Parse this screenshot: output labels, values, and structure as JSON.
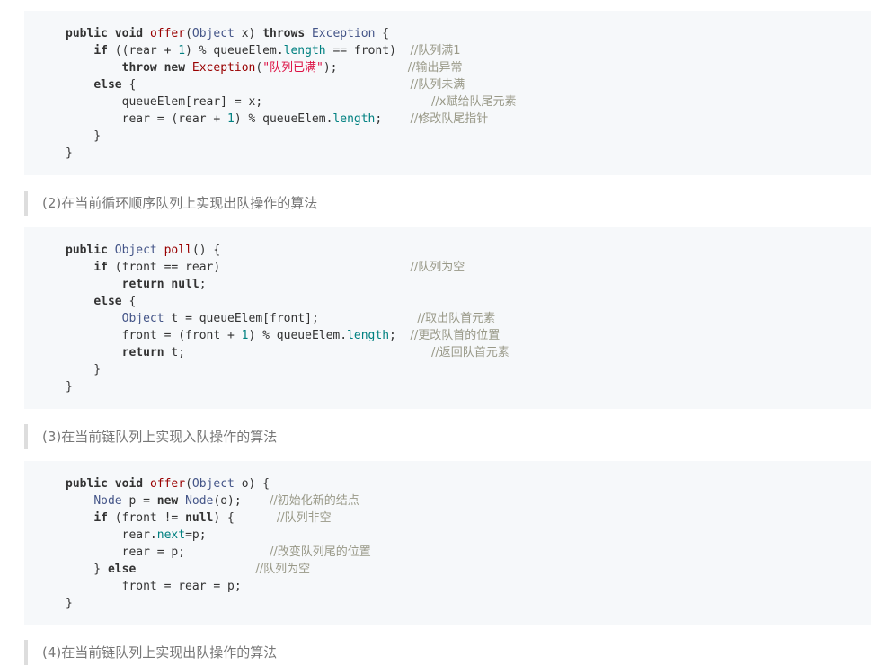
{
  "code_block_1": {
    "lines": [
      [
        [
          "kw",
          "public"
        ],
        [
          "t",
          " "
        ],
        [
          "kw",
          "void"
        ],
        [
          "t",
          " "
        ],
        [
          "fn",
          "offer"
        ],
        [
          "t",
          "("
        ],
        [
          "ty",
          "Object"
        ],
        [
          "t",
          " x) "
        ],
        [
          "kw",
          "throws"
        ],
        [
          "t",
          " "
        ],
        [
          "ty",
          "Exception"
        ],
        [
          "t",
          " {"
        ]
      ],
      [
        [
          "t",
          "    "
        ],
        [
          "kw",
          "if"
        ],
        [
          "t",
          " ((rear + "
        ],
        [
          "num",
          "1"
        ],
        [
          "t",
          ") % queueElem."
        ],
        [
          "prop",
          "length"
        ],
        [
          "t",
          " == front)  "
        ],
        [
          "cm",
          "//队列满1"
        ]
      ],
      [
        [
          "t",
          "        "
        ],
        [
          "kw",
          "throw"
        ],
        [
          "t",
          " "
        ],
        [
          "kw",
          "new"
        ],
        [
          "t",
          " "
        ],
        [
          "cls",
          "Exception"
        ],
        [
          "t",
          "("
        ],
        [
          "str",
          "\"队列已满\""
        ],
        [
          "t",
          ");          "
        ],
        [
          "cm",
          "//输出异常"
        ]
      ],
      [
        [
          "t",
          "    "
        ],
        [
          "kw",
          "else"
        ],
        [
          "t",
          " {                                       "
        ],
        [
          "cm",
          "//队列未满"
        ]
      ],
      [
        [
          "t",
          "        queueElem[rear] = x;                        "
        ],
        [
          "cm",
          "//x赋给队尾元素"
        ]
      ],
      [
        [
          "t",
          "        rear = (rear + "
        ],
        [
          "num",
          "1"
        ],
        [
          "t",
          ") % queueElem."
        ],
        [
          "prop",
          "length"
        ],
        [
          "t",
          ";    "
        ],
        [
          "cm",
          "//修改队尾指针"
        ]
      ],
      [
        [
          "t",
          "    }"
        ]
      ],
      [
        [
          "t",
          "}"
        ]
      ]
    ]
  },
  "quote_2": "(2)在当前循环顺序队列上实现出队操作的算法",
  "code_block_2": {
    "lines": [
      [
        [
          "kw",
          "public"
        ],
        [
          "t",
          " "
        ],
        [
          "ty",
          "Object"
        ],
        [
          "t",
          " "
        ],
        [
          "fn",
          "poll"
        ],
        [
          "t",
          "() {"
        ]
      ],
      [
        [
          "t",
          "    "
        ],
        [
          "kw",
          "if"
        ],
        [
          "t",
          " (front == rear)                           "
        ],
        [
          "cm",
          "//队列为空"
        ]
      ],
      [
        [
          "t",
          "        "
        ],
        [
          "kw",
          "return"
        ],
        [
          "t",
          " "
        ],
        [
          "kw",
          "null"
        ],
        [
          "t",
          ";"
        ]
      ],
      [
        [
          "t",
          "    "
        ],
        [
          "kw",
          "else"
        ],
        [
          "t",
          " {"
        ]
      ],
      [
        [
          "t",
          "        "
        ],
        [
          "ty",
          "Object"
        ],
        [
          "t",
          " t = queueElem[front];              "
        ],
        [
          "cm",
          "//取出队首元素"
        ]
      ],
      [
        [
          "t",
          "        front = (front + "
        ],
        [
          "num",
          "1"
        ],
        [
          "t",
          ") % queueElem."
        ],
        [
          "prop",
          "length"
        ],
        [
          "t",
          ";  "
        ],
        [
          "cm",
          "//更改队首的位置"
        ]
      ],
      [
        [
          "t",
          "        "
        ],
        [
          "kw",
          "return"
        ],
        [
          "t",
          " t;                                   "
        ],
        [
          "cm",
          "//返回队首元素"
        ]
      ],
      [
        [
          "t",
          "    }"
        ]
      ],
      [
        [
          "t",
          "}"
        ]
      ]
    ]
  },
  "quote_3": "(3)在当前链队列上实现入队操作的算法",
  "code_block_3": {
    "lines": [
      [
        [
          "kw",
          "public"
        ],
        [
          "t",
          " "
        ],
        [
          "kw",
          "void"
        ],
        [
          "t",
          " "
        ],
        [
          "fn",
          "offer"
        ],
        [
          "t",
          "("
        ],
        [
          "ty",
          "Object"
        ],
        [
          "t",
          " o) {"
        ]
      ],
      [
        [
          "t",
          "    "
        ],
        [
          "ty",
          "Node"
        ],
        [
          "t",
          " p = "
        ],
        [
          "kw",
          "new"
        ],
        [
          "t",
          " "
        ],
        [
          "ty",
          "Node"
        ],
        [
          "t",
          "(o);    "
        ],
        [
          "cm",
          "//初始化新的结点"
        ]
      ],
      [
        [
          "t",
          "    "
        ],
        [
          "kw",
          "if"
        ],
        [
          "t",
          " (front != "
        ],
        [
          "kw",
          "null"
        ],
        [
          "t",
          ") {      "
        ],
        [
          "cm",
          "//队列非空"
        ]
      ],
      [
        [
          "t",
          "        rear."
        ],
        [
          "prop",
          "next"
        ],
        [
          "t",
          "=p;"
        ]
      ],
      [
        [
          "t",
          "        rear = p;            "
        ],
        [
          "cm",
          "//改变队列尾的位置"
        ]
      ],
      [
        [
          "t",
          "    } "
        ],
        [
          "kw",
          "else"
        ],
        [
          "t",
          "                 "
        ],
        [
          "cm",
          "//队列为空"
        ]
      ],
      [
        [
          "t",
          "        front = rear = p;"
        ]
      ],
      [
        [
          "t",
          "}"
        ]
      ]
    ]
  },
  "quote_4": "(4)在当前链队列上实现出队操作的算法"
}
